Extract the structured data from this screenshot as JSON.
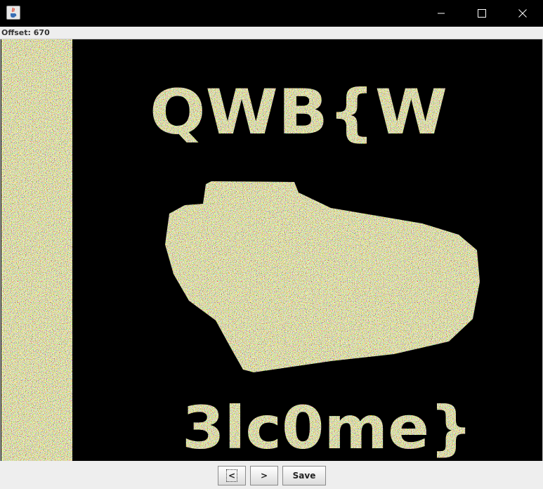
{
  "titlebar": {
    "app_icon": "java-cup-icon",
    "controls": [
      "minimize-icon",
      "maximize-icon",
      "close-icon"
    ]
  },
  "status": {
    "offset_label": "Offset: 670"
  },
  "image": {
    "text_top": "QWB{W",
    "text_bottom": "3lc0me}",
    "background_color": "#000000"
  },
  "buttons": {
    "prev_label": "<",
    "next_label": ">",
    "save_label": "Save"
  },
  "colors": {
    "window_chrome": "#000000",
    "panel_background": "#eeeeee",
    "noise_palette": [
      "#d6c84a",
      "#9fbf3c",
      "#e25b4f",
      "#4a7fd8",
      "#f0e060",
      "#58b45a",
      "#c86ad0",
      "#ffffff",
      "#3aa7a0",
      "#e39a3a"
    ]
  }
}
